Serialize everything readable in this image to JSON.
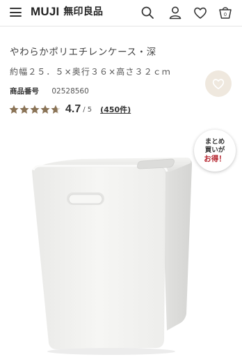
{
  "header": {
    "brand_latin": "MUJI",
    "brand_kanji": "無印良品",
    "cart_count": "0"
  },
  "product": {
    "title": "やわらかポリエチレンケース・深",
    "spec": "約幅２５．５×奥行３６×高さ３２ｃｍ",
    "code_label": "商品番号",
    "code_value": "02528560",
    "rating": {
      "score": "4.7",
      "max": "/ 5",
      "reviews": "(450件)",
      "stars": 4.7
    }
  },
  "badge": {
    "line1": "まとめ",
    "line2": "買いが",
    "line3": "お得！"
  },
  "colors": {
    "star": "#8a7356",
    "favorite_bg": "#efe8de",
    "badge_accent": "#b3202a"
  },
  "icons": [
    "menu-icon",
    "search-icon",
    "user-icon",
    "heart-icon",
    "cart-icon",
    "star-icon"
  ]
}
